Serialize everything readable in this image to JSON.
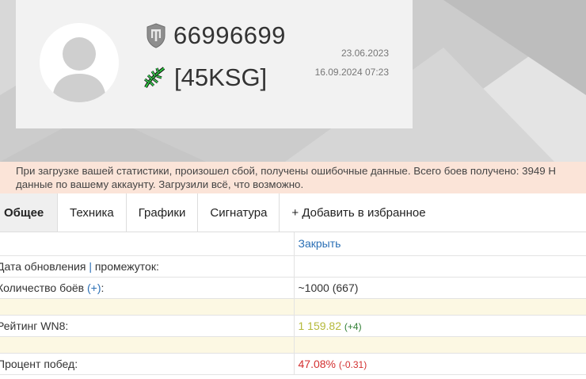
{
  "profile": {
    "player_id": "66996699",
    "clan_tag": "[45KSG]",
    "registration_date": "23.06.2023",
    "last_battle": "16.09.2024 07:23",
    "game_icon": "wot-shield-icon",
    "clan_icon": "clan-emblem-icon"
  },
  "alert": {
    "line1": "При загрузке вашей статистики, произошел сбой, получены ошибочные данные. Всего боев получено: 3949 Н",
    "line2": "данные по вашему аккаунту. Загрузили всё, что возможно."
  },
  "tabs": [
    {
      "label": "Общее"
    },
    {
      "label": "Техника"
    },
    {
      "label": "Графики"
    },
    {
      "label": "Сигнатура"
    },
    {
      "label": "+ Добавить в избранное"
    }
  ],
  "stats": {
    "close_label": "Закрыть",
    "update_label": "Дата обновления",
    "update_sep": "|",
    "update_interval": "промежуток:",
    "battles_label": "Количество боёв",
    "battles_plus": "(+)",
    "battles_colon": ":",
    "battles_value": "~1000 (667)",
    "wn8_label": "Рейтинг WN8:",
    "wn8_value": "1 159.82",
    "wn8_delta": "(+4)",
    "winrate_label": "Процент побед:",
    "winrate_value": "47.08%",
    "winrate_delta": "(-0.31)"
  },
  "colors": {
    "wn8": "#b5b93a",
    "positive": "#2e7d32",
    "negative": "#d32f2f",
    "link": "#2a6fb5",
    "alert_bg": "#fbe4d8",
    "highlight_row": "#fcf8e3"
  }
}
